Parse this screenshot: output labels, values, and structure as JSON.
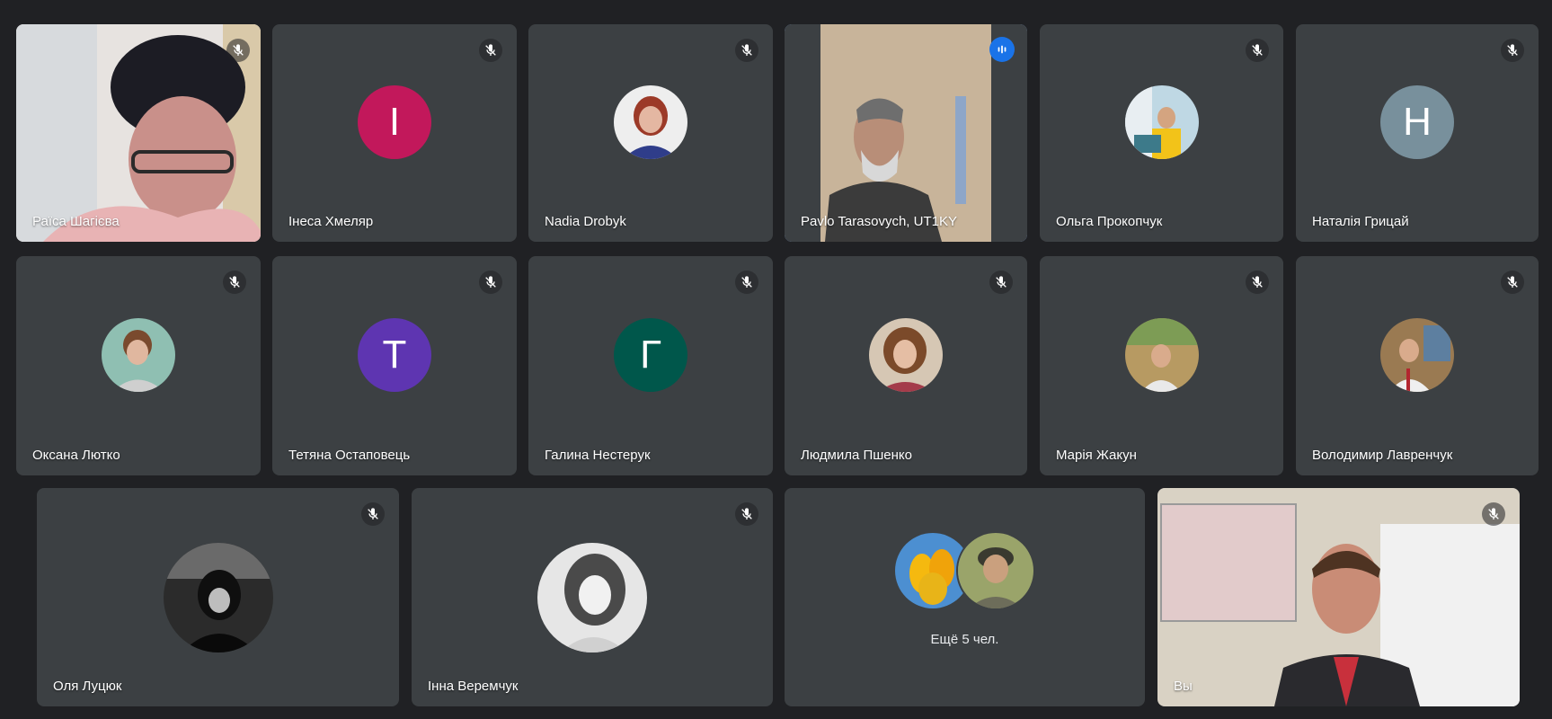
{
  "participants": [
    {
      "name": "Раїса Шагієва",
      "type": "video",
      "muted": true
    },
    {
      "name": "Інеса Хмеляр",
      "type": "initial",
      "initial": "І",
      "color": "#c2185b",
      "muted": true
    },
    {
      "name": "Nadia Drobyk",
      "type": "photo",
      "icon": "profile-photo-icon",
      "muted": true
    },
    {
      "name": "Pavlo Tarasovych, UT1KY",
      "type": "video",
      "speaking": true
    },
    {
      "name": "Ольга Прокопчук",
      "type": "photo",
      "icon": "profile-photo-icon",
      "muted": true
    },
    {
      "name": "Наталія Грицай",
      "type": "initial",
      "initial": "Н",
      "color": "#78909c",
      "muted": true
    },
    {
      "name": "Оксана Лютко",
      "type": "photo",
      "icon": "profile-photo-icon",
      "muted": true
    },
    {
      "name": "Тетяна Остаповець",
      "type": "initial",
      "initial": "Т",
      "color": "#5e35b1",
      "muted": true
    },
    {
      "name": "Галина Нестерук",
      "type": "initial",
      "initial": "Г",
      "color": "#00574b",
      "muted": true
    },
    {
      "name": "Людмила Пшенко",
      "type": "photo",
      "icon": "profile-photo-icon",
      "muted": true
    },
    {
      "name": "Марія Жакун",
      "type": "photo",
      "icon": "profile-photo-icon",
      "muted": true
    },
    {
      "name": "Володимир Лавренчук",
      "type": "photo",
      "icon": "profile-photo-icon",
      "muted": true
    },
    {
      "name": "Оля Луцюк",
      "type": "photo",
      "icon": "profile-photo-icon",
      "muted": true
    },
    {
      "name": "Інна Веремчук",
      "type": "photo",
      "icon": "profile-photo-icon",
      "muted": true
    },
    {
      "name": "Вы",
      "type": "video",
      "muted": true
    }
  ],
  "overflow": {
    "label": "Ещё 5 чел."
  },
  "colors": {
    "background": "#202124",
    "tile": "#3c4043",
    "active_border": "#8ab4f8",
    "speaking": "#1a73e8"
  }
}
